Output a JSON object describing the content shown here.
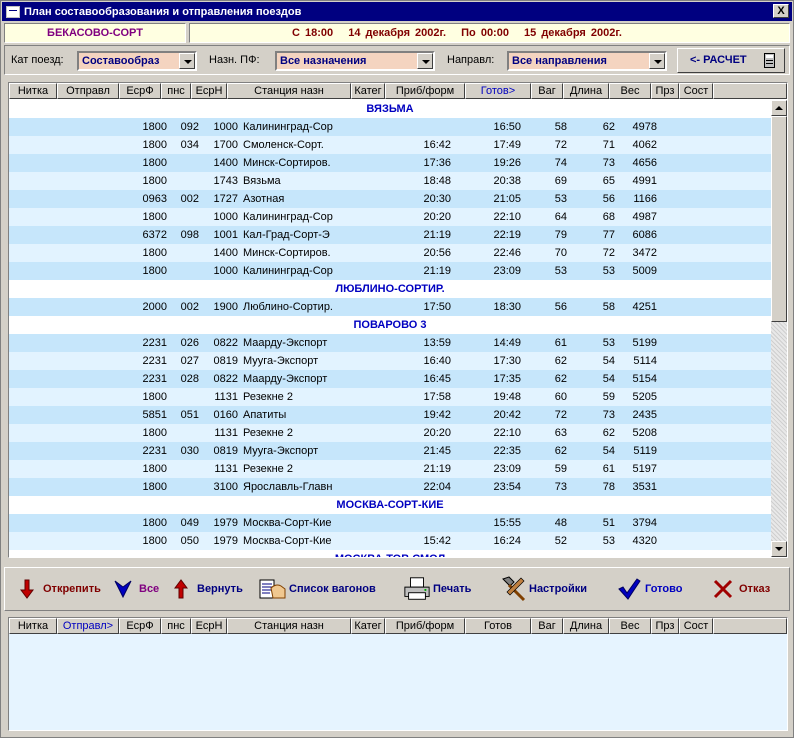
{
  "window": {
    "title": "План составообразования и отправления поездов",
    "close_label": "X"
  },
  "info": {
    "station": "БЕКАСОВО-СОРТ",
    "period_from": "С 18:00",
    "date_from": "14 декабря 2002г.",
    "period_to": "По 00:00",
    "date_to": "15 декабря 2002г."
  },
  "filters": {
    "cat_label": "Кат поезд:",
    "cat_value": "Составообраз",
    "dest_label": "Назн. ПФ:",
    "dest_value": "Все назначения",
    "dir_label": "Направл:",
    "dir_value": "Все направления",
    "calc_label": "<- РАСЧЕТ"
  },
  "grid1": {
    "columns": [
      "Нитка",
      "Отправл",
      "ЕсрФ",
      "пнс",
      "ЕсрН",
      "Станция назн",
      "Катег",
      "Приб/форм",
      "Готов>",
      "Ваг",
      "Длина",
      "Вес",
      "Прз",
      "Сост"
    ],
    "groups": [
      {
        "name": "ВЯЗЬМА",
        "rows": [
          {
            "esrf": "1800",
            "pns": "092",
            "esrn": "1000",
            "station": "Калининград-Сор",
            "arr": "",
            "ready": "16:50",
            "vag": "58",
            "len": "62",
            "weight": "4978"
          },
          {
            "esrf": "1800",
            "pns": "034",
            "esrn": "1700",
            "station": "Смоленск-Сорт.",
            "arr": "16:42",
            "ready": "17:49",
            "vag": "72",
            "len": "71",
            "weight": "4062"
          },
          {
            "esrf": "1800",
            "pns": "",
            "esrn": "1400",
            "station": "Минск-Сортиров.",
            "arr": "17:36",
            "ready": "19:26",
            "vag": "74",
            "len": "73",
            "weight": "4656"
          },
          {
            "esrf": "1800",
            "pns": "",
            "esrn": "1743",
            "station": "Вязьма",
            "arr": "18:48",
            "ready": "20:38",
            "vag": "69",
            "len": "65",
            "weight": "4991"
          },
          {
            "esrf": "0963",
            "pns": "002",
            "esrn": "1727",
            "station": "Азотная",
            "arr": "20:30",
            "ready": "21:05",
            "vag": "53",
            "len": "56",
            "weight": "1166"
          },
          {
            "esrf": "1800",
            "pns": "",
            "esrn": "1000",
            "station": "Калининград-Сор",
            "arr": "20:20",
            "ready": "22:10",
            "vag": "64",
            "len": "68",
            "weight": "4987"
          },
          {
            "esrf": "6372",
            "pns": "098",
            "esrn": "1001",
            "station": "Кал-Град-Сорт-Э",
            "arr": "21:19",
            "ready": "22:19",
            "vag": "79",
            "len": "77",
            "weight": "6086"
          },
          {
            "esrf": "1800",
            "pns": "",
            "esrn": "1400",
            "station": "Минск-Сортиров.",
            "arr": "20:56",
            "ready": "22:46",
            "vag": "70",
            "len": "72",
            "weight": "3472"
          },
          {
            "esrf": "1800",
            "pns": "",
            "esrn": "1000",
            "station": "Калининград-Сор",
            "arr": "21:19",
            "ready": "23:09",
            "vag": "53",
            "len": "53",
            "weight": "5009"
          }
        ]
      },
      {
        "name": "ЛЮБЛИНО-СОРТИР.",
        "rows": [
          {
            "esrf": "2000",
            "pns": "002",
            "esrn": "1900",
            "station": "Люблино-Сортир.",
            "arr": "17:50",
            "ready": "18:30",
            "vag": "56",
            "len": "58",
            "weight": "4251"
          }
        ]
      },
      {
        "name": "ПОВАРОВО 3",
        "rows": [
          {
            "esrf": "2231",
            "pns": "026",
            "esrn": "0822",
            "station": "Маарду-Экспорт",
            "arr": "13:59",
            "ready": "14:49",
            "vag": "61",
            "len": "53",
            "weight": "5199"
          },
          {
            "esrf": "2231",
            "pns": "027",
            "esrn": "0819",
            "station": "Мууга-Экспорт",
            "arr": "16:40",
            "ready": "17:30",
            "vag": "62",
            "len": "54",
            "weight": "5114"
          },
          {
            "esrf": "2231",
            "pns": "028",
            "esrn": "0822",
            "station": "Маарду-Экспорт",
            "arr": "16:45",
            "ready": "17:35",
            "vag": "62",
            "len": "54",
            "weight": "5154"
          },
          {
            "esrf": "1800",
            "pns": "",
            "esrn": "1131",
            "station": "Резекне 2",
            "arr": "17:58",
            "ready": "19:48",
            "vag": "60",
            "len": "59",
            "weight": "5205"
          },
          {
            "esrf": "5851",
            "pns": "051",
            "esrn": "0160",
            "station": "Апатиты",
            "arr": "19:42",
            "ready": "20:42",
            "vag": "72",
            "len": "73",
            "weight": "2435"
          },
          {
            "esrf": "1800",
            "pns": "",
            "esrn": "1131",
            "station": "Резекне 2",
            "arr": "20:20",
            "ready": "22:10",
            "vag": "63",
            "len": "62",
            "weight": "5208"
          },
          {
            "esrf": "2231",
            "pns": "030",
            "esrn": "0819",
            "station": "Мууга-Экспорт",
            "arr": "21:45",
            "ready": "22:35",
            "vag": "62",
            "len": "54",
            "weight": "5119"
          },
          {
            "esrf": "1800",
            "pns": "",
            "esrn": "1131",
            "station": "Резекне 2",
            "arr": "21:19",
            "ready": "23:09",
            "vag": "59",
            "len": "61",
            "weight": "5197"
          },
          {
            "esrf": "1800",
            "pns": "",
            "esrn": "3100",
            "station": "Ярославль-Главн",
            "arr": "22:04",
            "ready": "23:54",
            "vag": "73",
            "len": "78",
            "weight": "3531"
          }
        ]
      },
      {
        "name": "МОСКВА-СОРТ-КИЕ",
        "rows": [
          {
            "esrf": "1800",
            "pns": "049",
            "esrn": "1979",
            "station": "Москва-Сорт-Кие",
            "arr": "",
            "ready": "15:55",
            "vag": "48",
            "len": "51",
            "weight": "3794"
          },
          {
            "esrf": "1800",
            "pns": "050",
            "esrn": "1979",
            "station": "Москва-Сорт-Кие",
            "arr": "15:42",
            "ready": "16:24",
            "vag": "52",
            "len": "53",
            "weight": "4320"
          }
        ]
      },
      {
        "name": "МОСКВА-ТОВ.СМОЛ",
        "rows": []
      }
    ]
  },
  "toolbar": {
    "unpin": "Открепить",
    "all": "Все",
    "return": "Вернуть",
    "wagons": "Список вагонов",
    "print": "Печать",
    "settings": "Настройки",
    "ready": "Готово",
    "cancel": "Отказ"
  },
  "grid2": {
    "columns": [
      "Нитка",
      "Отправл>",
      "ЕсрФ",
      "пнс",
      "ЕсрН",
      "Станция назн",
      "Катег",
      "Приб/форм",
      "Готов",
      "Ваг",
      "Длина",
      "Вес",
      "Прз",
      "Сост"
    ]
  },
  "colors": {
    "title_bg": "#000080",
    "row_a": "#c6e6fb",
    "row_b": "#e2f3ff",
    "group_text": "#0000c0",
    "combo_bg": "#f4d4c0",
    "accent_red": "#c00000",
    "accent_blue": "#0000c0"
  }
}
